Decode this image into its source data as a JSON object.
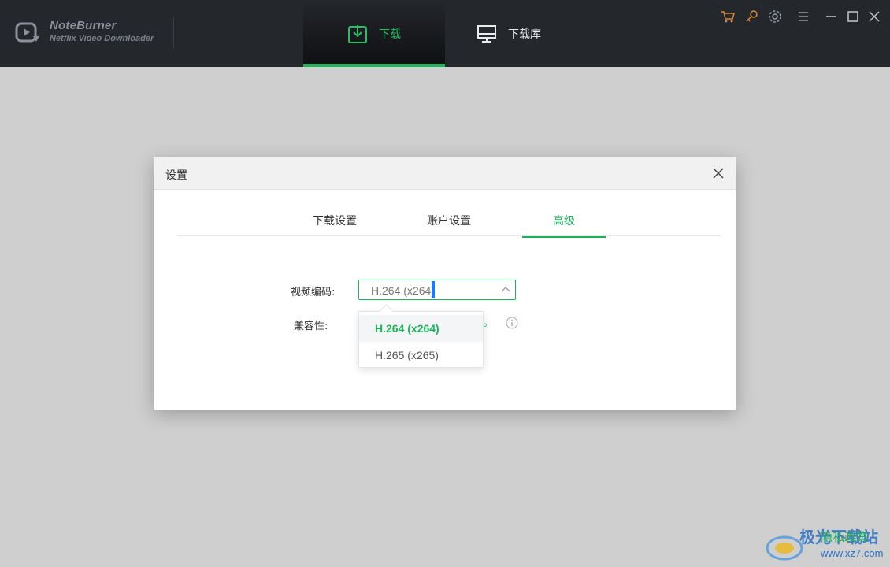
{
  "app": {
    "brand_name": "NoteBurner",
    "brand_sub": "Netflix Video Downloader"
  },
  "nav": {
    "download": "下载",
    "library": "下载库"
  },
  "titlebar_icons": [
    "cart-icon",
    "key-icon",
    "gear-icon",
    "menu-icon",
    "minimize-icon",
    "maximize-icon",
    "close-icon"
  ],
  "dialog": {
    "title": "设置",
    "tabs": [
      "下载设置",
      "账户设置",
      "高级"
    ],
    "active_tab": "高级",
    "video_codec_label": "视频编码:",
    "video_codec_value": "H.264 (x264)",
    "compat_label": "兼容性:",
    "compat_fragment": "。",
    "dropdown_options": [
      "H.264 (x264)",
      "H.265 (x265)"
    ]
  },
  "footer": {
    "privacy": "隐私政策",
    "watermark_cn": "极光下载站",
    "watermark_url": "www.xz7.com"
  },
  "colors": {
    "accent": "#1fb25a",
    "titlebar": "#24272c",
    "overlay": "#cfcfcf"
  }
}
